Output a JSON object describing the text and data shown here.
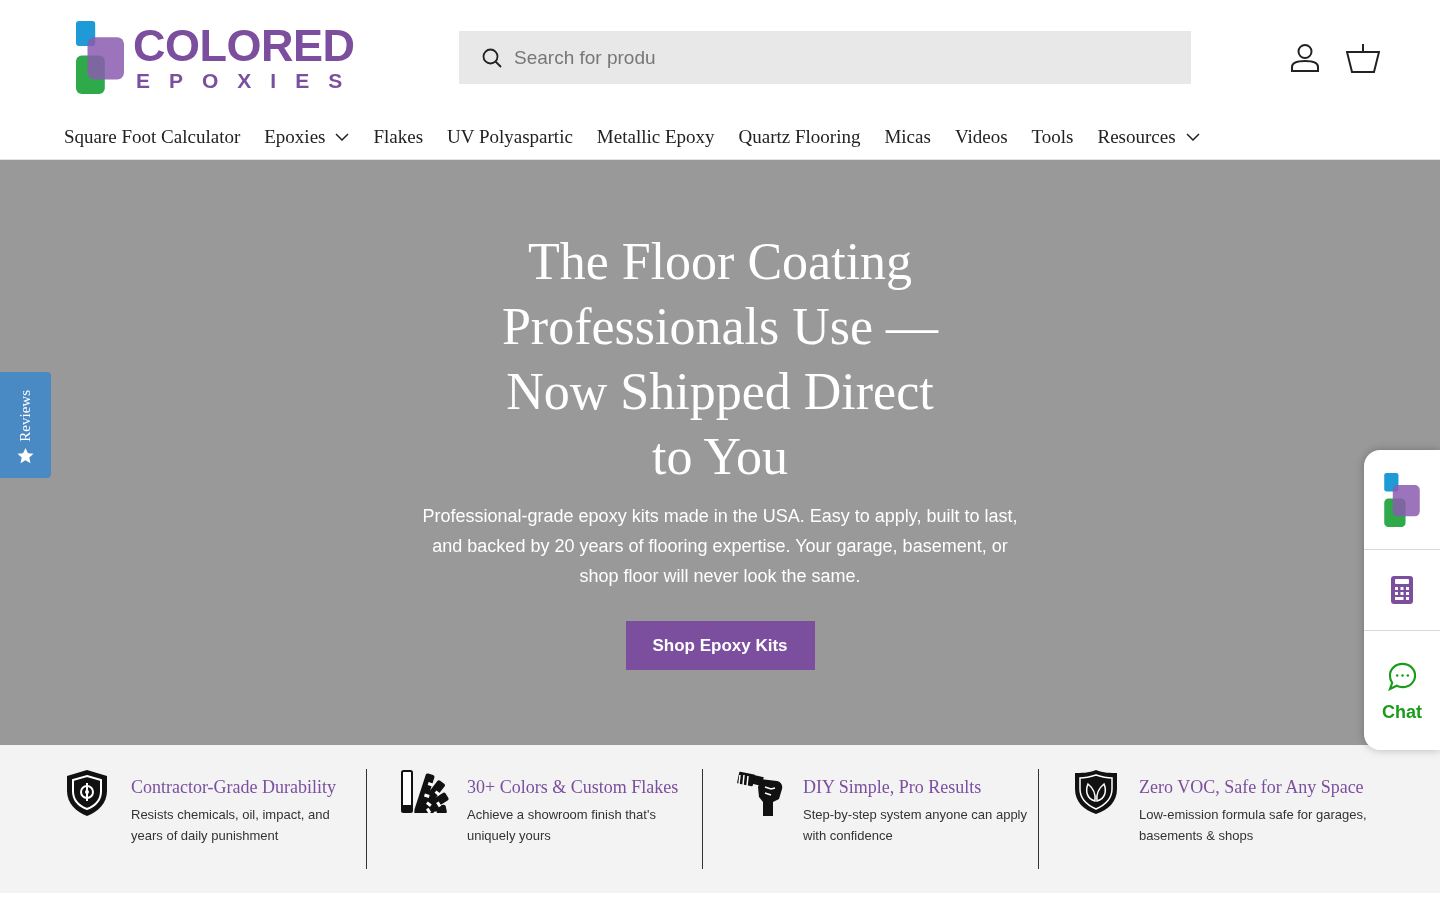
{
  "header": {
    "logo": {
      "word": "COLORED",
      "subword": "EPOXIES"
    },
    "search": {
      "placeholder": "Search for produ"
    }
  },
  "nav": [
    {
      "label": "Square Foot Calculator",
      "has_dropdown": false
    },
    {
      "label": "Epoxies",
      "has_dropdown": true
    },
    {
      "label": "Flakes",
      "has_dropdown": false
    },
    {
      "label": "UV Polyaspartic",
      "has_dropdown": false
    },
    {
      "label": "Metallic Epoxy",
      "has_dropdown": false
    },
    {
      "label": "Quartz Flooring",
      "has_dropdown": false
    },
    {
      "label": "Micas",
      "has_dropdown": false
    },
    {
      "label": "Videos",
      "has_dropdown": false
    },
    {
      "label": "Tools",
      "has_dropdown": false
    },
    {
      "label": "Resources",
      "has_dropdown": true
    }
  ],
  "reviews_tab": {
    "label": "Reviews"
  },
  "hero": {
    "title": "The Floor Coating Professionals Use — Now Shipped Direct to You",
    "subtitle": "Professional-grade epoxy kits made in the USA. Easy to apply, built to last, and backed by 20 years of flooring expertise. Your garage, basement, or shop floor will never look the same.",
    "button": "Shop Epoxy Kits"
  },
  "side_widget": {
    "chat_label": "Chat"
  },
  "features": [
    {
      "title": "Contractor-Grade Durability",
      "text": "Resists chemicals, oil, impact, and years of daily punishment"
    },
    {
      "title": "30+ Colors & Custom Flakes",
      "text": "Achieve a showroom finish that's uniquely yours"
    },
    {
      "title": "DIY Simple, Pro Results",
      "text": "Step-by-step system anyone can apply with confidence"
    },
    {
      "title": "Zero VOC, Safe for Any Space",
      "text": "Low-emission formula safe for garages, basements & shops"
    }
  ]
}
